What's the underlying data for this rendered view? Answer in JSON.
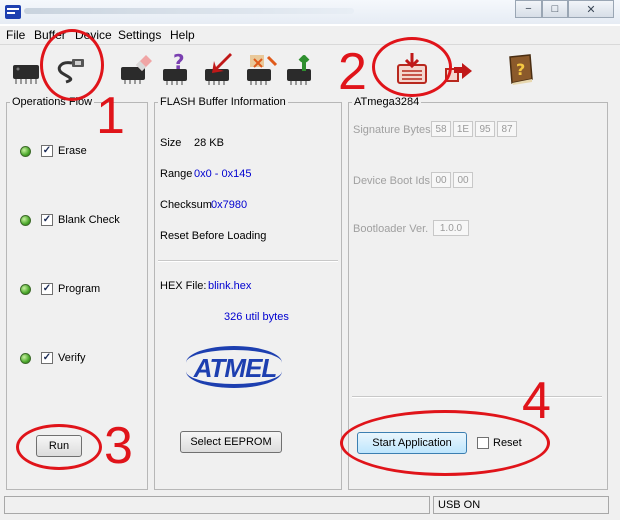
{
  "window": {
    "minimize_label": "−",
    "maximize_label": "□",
    "close_label": "✕"
  },
  "menu": [
    "File",
    "Buffer",
    "Device",
    "Settings",
    "Help"
  ],
  "toolbar": {
    "icons": [
      "chip-icon",
      "usb-cable-icon",
      "erase-chip-icon",
      "blank-check-icon",
      "program-chip-icon",
      "verify-chip-icon",
      "read-chip-icon",
      "load-hex-icon",
      "undo-icon",
      "help-book-icon"
    ]
  },
  "operations": {
    "title": "Operations Flow",
    "items": [
      {
        "label": "Erase",
        "checked": true
      },
      {
        "label": "Blank Check",
        "checked": true
      },
      {
        "label": "Program",
        "checked": true
      },
      {
        "label": "Verify",
        "checked": true
      }
    ],
    "run_label": "Run"
  },
  "flash": {
    "title": "FLASH Buffer Information",
    "size_label": "Size",
    "size_value": "28 KB",
    "range_label": "Range",
    "range_value": "0x0 - 0x145",
    "checksum_label": "Checksum",
    "checksum_value": "0x7980",
    "reset_label": "Reset Before Loading",
    "hex_label": "HEX File:",
    "hex_value": "blink.hex",
    "util_bytes": "326 util bytes",
    "logo_text": "ATMEL",
    "select_eeprom_label": "Select EEPROM"
  },
  "device": {
    "title": "ATmega3284",
    "signature_label": "Signature Bytes",
    "signature_bytes": [
      "58",
      "1E",
      "95",
      "87"
    ],
    "boot_ids_label": "Device Boot Ids",
    "boot_ids": [
      "00",
      "00"
    ],
    "bootloader_label": "Bootloader Ver.",
    "bootloader_value": "1.0.0",
    "start_app_label": "Start Application",
    "reset_label": "Reset",
    "reset_checked": false
  },
  "status": {
    "connection": "USB ON"
  },
  "annotations": {
    "numbers": [
      "1",
      "2",
      "3",
      "4"
    ]
  },
  "colors": {
    "annotation_red": "#e0141a",
    "value_blue": "#0000d0",
    "logo_blue": "#1d3fb0"
  }
}
